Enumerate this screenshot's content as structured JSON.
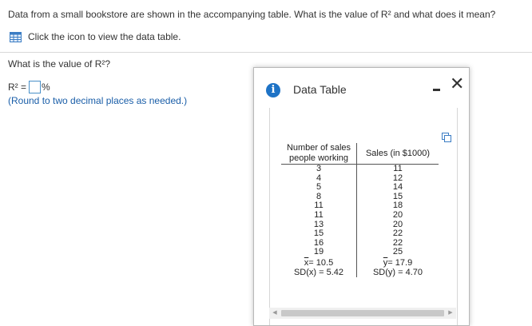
{
  "question": {
    "text": "Data from a small bookstore are shown in the accompanying table. What is the value of R² and what does it mean?",
    "table_link": "Click the icon to view the data table.",
    "prompt": "What is the value of R²?",
    "answer_prefix": "R² =",
    "answer_suffix": "%",
    "answer_value": "",
    "round_note": "(Round to two decimal places as needed.)"
  },
  "modal": {
    "title": "Data Table",
    "table": {
      "col1_header": "Number of sales people working",
      "col2_header": "Sales (in $1000)",
      "rows": [
        [
          "3",
          "11"
        ],
        [
          "4",
          "12"
        ],
        [
          "5",
          "14"
        ],
        [
          "8",
          "15"
        ],
        [
          "11",
          "18"
        ],
        [
          "11",
          "20"
        ],
        [
          "13",
          "20"
        ],
        [
          "15",
          "22"
        ],
        [
          "16",
          "22"
        ],
        [
          "19",
          "25"
        ]
      ],
      "stats": {
        "xbar_sym": "x",
        "xbar_val": "= 10.5",
        "ybar_sym": "y",
        "ybar_val": "= 17.9",
        "sdx": "SD(x) = 5.42",
        "sdy": "SD(y) = 4.70"
      }
    }
  },
  "colors": {
    "accent": "#1e73c6",
    "link_text": "#1a5ea8",
    "input_border": "#4a90c8"
  },
  "icons": [
    "table-grid-icon",
    "info-icon",
    "minimize-icon",
    "close-icon",
    "copy-icon",
    "scroll-left-icon",
    "scroll-right-icon"
  ]
}
